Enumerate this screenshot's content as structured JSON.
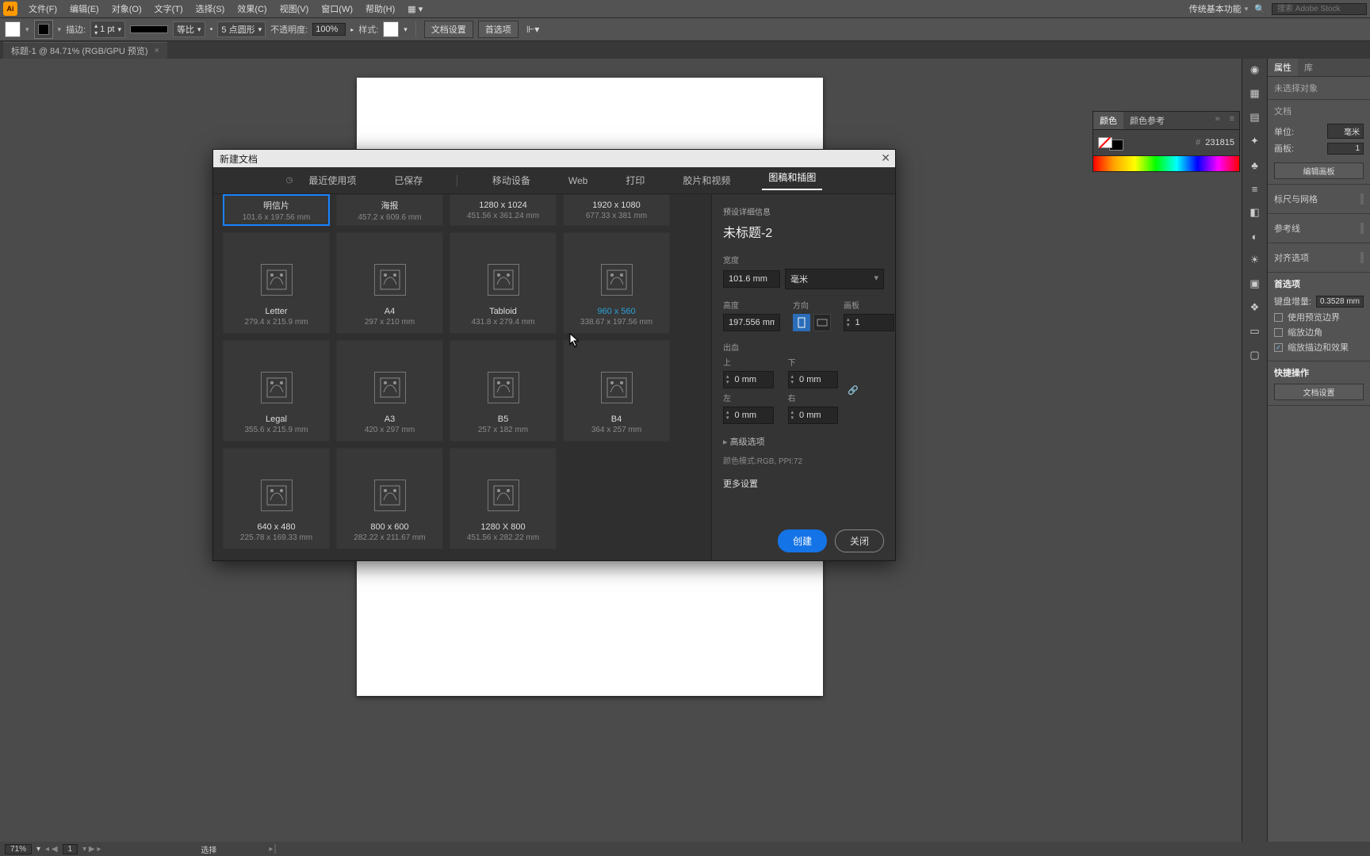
{
  "menubar": {
    "items": [
      "文件(F)",
      "编辑(E)",
      "对象(O)",
      "文字(T)",
      "选择(S)",
      "效果(C)",
      "视图(V)",
      "窗口(W)",
      "帮助(H)"
    ],
    "workspace": "传统基本功能",
    "search_placeholder": "搜索 Adobe Stock"
  },
  "optbar": {
    "stroke_label": "描边:",
    "stroke_w": "1 pt",
    "uniform": "等比",
    "dash": "5 点圆形",
    "opacity_label": "不透明度:",
    "opacity": "100%",
    "style_label": "样式:",
    "doc_setup": "文档设置",
    "prefs": "首选项"
  },
  "doc_tab": "标题-1 @ 84.71% (RGB/GPU 预览)",
  "color_panel": {
    "tab1": "颜色",
    "tab2": "颜色参考",
    "hex": "231815"
  },
  "right": {
    "tab_props": "属性",
    "tab_lib": "库",
    "no_sel": "未选择对象",
    "doc_hd": "文档",
    "unit_lbl": "单位:",
    "unit_v": "毫米",
    "artboard_lbl": "画板:",
    "artboard_v": "1",
    "edit_artboards": "编辑画板",
    "ruler_hd": "标尺与网格",
    "guides_hd": "参考线",
    "align_hd": "对齐选项",
    "prefs_hd": "首选项",
    "key_inc_lbl": "键盘增量:",
    "key_inc_v": "0.3528 mm",
    "chk_preview": "使用预览边界",
    "chk_corner": "缩放边角",
    "chk_stroke": "缩放描边和效果",
    "quick_hd": "快捷操作",
    "quick_btn": "文档设置"
  },
  "modal": {
    "title": "新建文档",
    "nav": {
      "recent": "最近使用项",
      "saved": "已保存",
      "mobile": "移动设备",
      "web": "Web",
      "print": "打印",
      "film": "胶片和视频",
      "art": "图稿和插图"
    },
    "presets": [
      {
        "name": "明信片",
        "dim": "101.6 x 197.56 mm",
        "short": true,
        "selected": true
      },
      {
        "name": "海报",
        "dim": "457.2 x 609.6 mm",
        "short": true
      },
      {
        "name": "1280 x 1024",
        "dim": "451.56 x 361.24 mm",
        "short": true
      },
      {
        "name": "1920 x 1080",
        "dim": "677.33 x 381 mm",
        "short": true
      },
      {
        "name": "Letter",
        "dim": "279.4 x 215.9 mm"
      },
      {
        "name": "A4",
        "dim": "297 x 210 mm"
      },
      {
        "name": "Tabloid",
        "dim": "431.8 x 279.4 mm"
      },
      {
        "name": "960 x 560",
        "dim": "338.67 x 197.56 mm",
        "highlight": true
      },
      {
        "name": "Legal",
        "dim": "355.6 x 215.9 mm"
      },
      {
        "name": "A3",
        "dim": "420 x 297 mm"
      },
      {
        "name": "B5",
        "dim": "257 x 182 mm"
      },
      {
        "name": "B4",
        "dim": "364 x 257 mm"
      },
      {
        "name": "640 x 480",
        "dim": "225.78 x 169.33 mm"
      },
      {
        "name": "800 x 600",
        "dim": "282.22 x 211.67 mm"
      },
      {
        "name": "1280 X 800",
        "dim": "451.56 x 282.22 mm"
      }
    ],
    "detail": {
      "hd": "预设详细信息",
      "title": "未标题-2",
      "width_lbl": "宽度",
      "width_v": "101.6 mm",
      "unit": "毫米",
      "height_lbl": "高度",
      "height_v": "197.556 mm",
      "orient_lbl": "方向",
      "artboards_lbl": "画板",
      "artboards_v": "1",
      "bleed_lbl": "出血",
      "top": "上",
      "bottom": "下",
      "left": "左",
      "right": "右",
      "b_v": "0 mm",
      "adv": "高级选项",
      "meta": "颜色模式:RGB, PPI:72",
      "more": "更多设置",
      "create": "创建",
      "close": "关闭"
    }
  },
  "status": {
    "zoom": "71%",
    "ab": "1",
    "sel": "选择"
  }
}
